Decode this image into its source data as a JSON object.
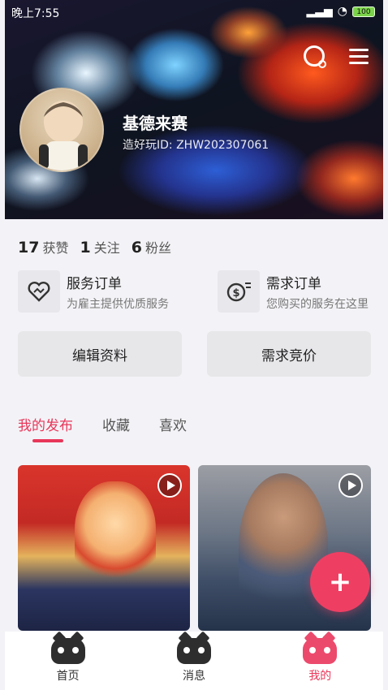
{
  "status_bar": {
    "time": "晚上7:55",
    "battery": "100"
  },
  "profile": {
    "name": "基德来赛",
    "id_label": "造好玩ID: ZHW202307061"
  },
  "stats": [
    {
      "count": "17",
      "label": "获赞"
    },
    {
      "count": "1",
      "label": "关注"
    },
    {
      "count": "6",
      "label": "粉丝"
    }
  ],
  "orders": {
    "service": {
      "title": "服务订单",
      "subtitle": "为雇主提供优质服务"
    },
    "demand": {
      "title": "需求订单",
      "subtitle": "您购买的服务在这里"
    }
  },
  "buttons": {
    "edit_profile": "编辑资料",
    "demand_bidding": "需求竞价"
  },
  "tabs": [
    {
      "label": "我的发布",
      "active": true
    },
    {
      "label": "收藏",
      "active": false
    },
    {
      "label": "喜欢",
      "active": false
    }
  ],
  "fab": {
    "symbol": "+"
  },
  "bottom_nav": [
    {
      "label": "首页",
      "active": false
    },
    {
      "label": "消息",
      "active": false
    },
    {
      "label": "我的",
      "active": true
    }
  ],
  "colors": {
    "accent": "#e8375a",
    "fab": "#ee3f63",
    "background": "#f3f3f7"
  }
}
